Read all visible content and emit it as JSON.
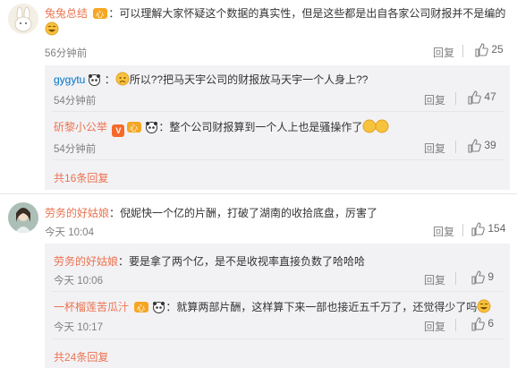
{
  "comments": [
    {
      "user": "兔兔总结",
      "text": "：可以理解大家怀疑这个数据的真实性，但是这些都是出自各家公司财报并不是编的",
      "time": "56分钟前",
      "reply_label": "回复",
      "likes": "25",
      "replies": [
        {
          "user": "gygytu",
          "text": "所以??把马天宇公司的财报放马天宇一个人身上??",
          "time": "54分钟前",
          "reply_label": "回复",
          "likes": "47"
        },
        {
          "user": "斫黎小公举",
          "text": "：整个公司财报算到一个人上也是骚操作了",
          "time": "54分钟前",
          "reply_label": "回复",
          "likes": "39"
        }
      ],
      "more": "共16条回复"
    },
    {
      "user": "劳务的好姑娘",
      "text": "：倪妮快一个亿的片酬，打破了湖南的收拾底盘，厉害了",
      "time": "今天 10:04",
      "reply_label": "回复",
      "likes": "154",
      "replies": [
        {
          "user": "劳务的好姑娘",
          "text": "：要是拿了两个亿，是不是收视率直接负数了哈哈哈",
          "time": "今天 10:06",
          "reply_label": "回复",
          "likes": "9"
        },
        {
          "user": "一杯榴莲苦瓜汁",
          "text": "：就算两部片酬，这样算下来一部也接近五千万了，还觉得少了吗",
          "time": "今天 10:17",
          "reply_label": "回复",
          "likes": "6"
        }
      ],
      "more": "共24条回复"
    }
  ]
}
